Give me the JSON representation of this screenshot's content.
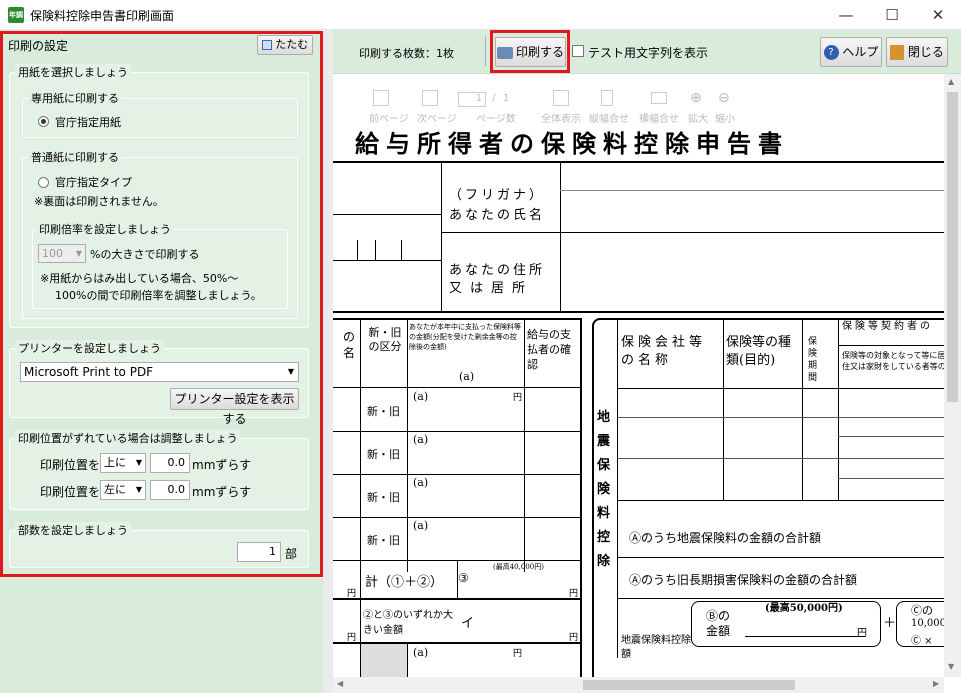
{
  "window": {
    "title": "保険料控除申告書印刷画面",
    "app_icon": "年調"
  },
  "left": {
    "header": "印刷の設定",
    "collapse": "たたむ",
    "paper": {
      "legend": "用紙を選択しましょう",
      "special": {
        "legend": "専用紙に印刷する",
        "option": "官庁指定用紙"
      },
      "plain": {
        "legend": "普通紙に印刷する",
        "option": "官庁指定タイプ",
        "note": "※裏面は印刷されません。",
        "scale": {
          "legend": "印刷倍率を設定しましょう",
          "value": "100",
          "suffix": "%の大きさで印刷する",
          "note1": "※用紙からはみ出している場合、50%～",
          "note2": "100%の間で印刷倍率を調整しましょう。"
        }
      }
    },
    "printer": {
      "legend": "プリンターを設定しましょう",
      "selected": "Microsoft Print to PDF",
      "button": "プリンター設定を表示する"
    },
    "offset": {
      "legend": "印刷位置がずれている場合は調整しましょう",
      "row1": {
        "label": "印刷位置を",
        "dir": "上に",
        "value": "0.0",
        "unit": "mmずらす"
      },
      "row2": {
        "label": "印刷位置を",
        "dir": "左に",
        "value": "0.0",
        "unit": "mmずらす"
      }
    },
    "copies": {
      "legend": "部数を設定しましょう",
      "value": "1",
      "unit": "部"
    }
  },
  "toolbar": {
    "count": "印刷する枚数：1枚",
    "print": "印刷する",
    "test_label": "テスト用文字列を表示",
    "help": "ヘルプ",
    "close": "閉じる"
  },
  "viewer": {
    "prev": "前ページ",
    "next": "次ページ",
    "page_current": "1",
    "page_sep": "/",
    "page_total": "1",
    "page_count_label": "ページ数",
    "fit_all": "全体表示",
    "fit_height": "縦幅合せ",
    "fit_width": "横幅合せ",
    "zoom_in": "拡大",
    "zoom_out": "縮小"
  },
  "doc": {
    "title": "給与所得者の保険料控除申告書",
    "furigana": "（フリガナ）",
    "name_label": "あなたの氏名",
    "addr1": "あなたの住所",
    "addr2": "又は居所",
    "col_no": "の名",
    "col_shin": "新・旧の区分",
    "col_amount": "あなたが本年中に支払った保険料等の金額(分配を受けた剰余金等の控除後の金額)",
    "col_a": "(a)",
    "col_kyuyo": "給与の支払者の確認",
    "row_label": "新・旧",
    "row_a": "(a)",
    "yen": "円",
    "total": "計（①＋②）",
    "total3": "③",
    "max40": "(最高40,000円)",
    "kei_q": "②と③のいずれか大きい金額",
    "i_mark": "イ",
    "r_hoken": "保険会社等の名称",
    "r_shurui": "保険等の種類(目的)",
    "r_kikan": "保険期間",
    "r_keiyaku": "保険等契約者の",
    "r_note": "保険等の対象となって等に居住又は家財をしている者等の",
    "jishin": "地震保険料控除",
    "sum1": "Ⓐのうち地震保険料の金額の合計額",
    "sum2": "Ⓐのうち旧長期損害保険料の金額の合計額",
    "kojo": "地震保険料控除額",
    "b_label": "Ⓑの金額",
    "max50": "(最高50,000円)",
    "plus": "＋",
    "c1": "Ⓒの",
    "c2": "10,000",
    "c3": "Ⓒ ×"
  }
}
